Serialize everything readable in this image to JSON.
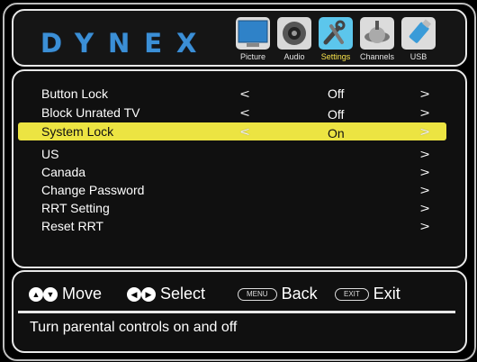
{
  "brand": {
    "logo": "DYNEX"
  },
  "tabs": [
    {
      "label": "Picture",
      "icon": "picture-icon",
      "active": false
    },
    {
      "label": "Audio",
      "icon": "audio-icon",
      "active": false
    },
    {
      "label": "Settings",
      "icon": "settings-icon",
      "active": true
    },
    {
      "label": "Channels",
      "icon": "channels-icon",
      "active": false
    },
    {
      "label": "USB",
      "icon": "usb-icon",
      "active": false
    }
  ],
  "menu": {
    "items": [
      {
        "label": "Button Lock",
        "value": "Off",
        "left_arrow": "<",
        "right_arrow": ">"
      },
      {
        "label": "Block Unrated TV",
        "value": "Off",
        "left_arrow": "<",
        "right_arrow": ">"
      },
      {
        "label": "System Lock",
        "value": "On",
        "left_arrow": "<",
        "right_arrow": ">",
        "selected": true
      },
      {
        "label": "US",
        "value": "",
        "right_arrow": ">"
      },
      {
        "label": "Canada",
        "value": "",
        "right_arrow": ">"
      },
      {
        "label": "Change Password",
        "value": "",
        "right_arrow": ">"
      },
      {
        "label": "RRT Setting",
        "value": "",
        "right_arrow": ">"
      },
      {
        "label": "Reset RRT",
        "value": "",
        "right_arrow": ">"
      }
    ]
  },
  "footer": {
    "move": "Move",
    "select": "Select",
    "menu_key": "MENU",
    "back": "Back",
    "exit_key": "EXIT",
    "exit": "Exit",
    "description": "Turn parental controls on and off"
  },
  "colors": {
    "highlight": "#ece442",
    "brand_blue": "#3b8fd6",
    "active_tab": "#38b4e0"
  }
}
